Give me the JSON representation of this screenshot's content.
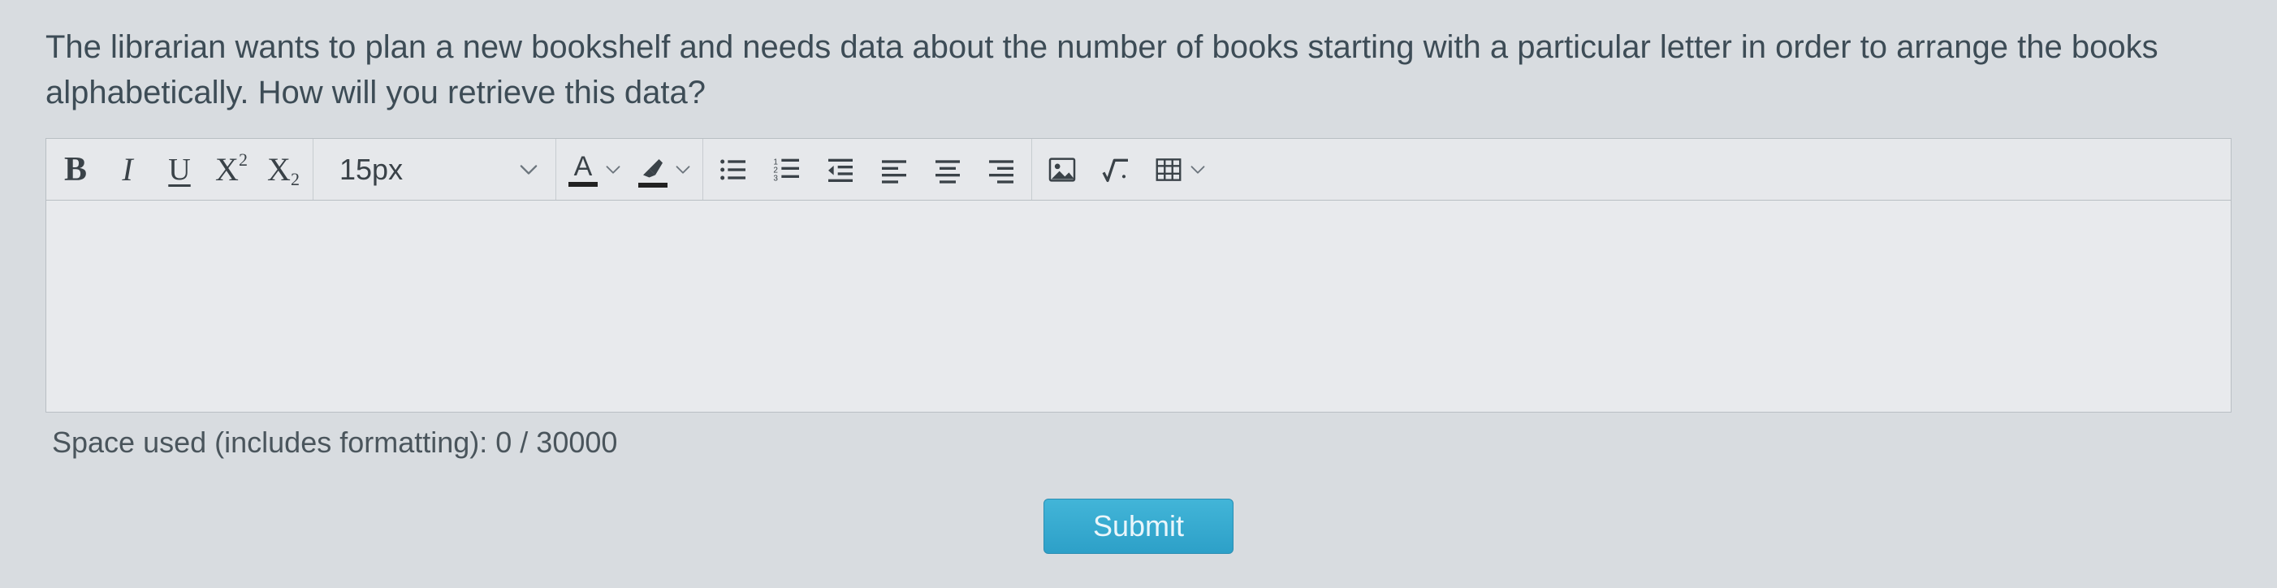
{
  "question": {
    "text": "The librarian wants to plan a new bookshelf and needs data about the number of books starting with a particular letter in order to arrange the books alphabetically. How will you retrieve this data?"
  },
  "toolbar": {
    "bold_label": "B",
    "italic_label": "I",
    "underline_label": "U",
    "superscript_base": "X",
    "superscript_sup": "2",
    "subscript_base": "X",
    "subscript_sub": "2",
    "fontsize_value": "15px",
    "textcolor_letter": "A"
  },
  "status": {
    "text": "Space used (includes formatting): 0 / 30000"
  },
  "submit": {
    "label": "Submit"
  }
}
